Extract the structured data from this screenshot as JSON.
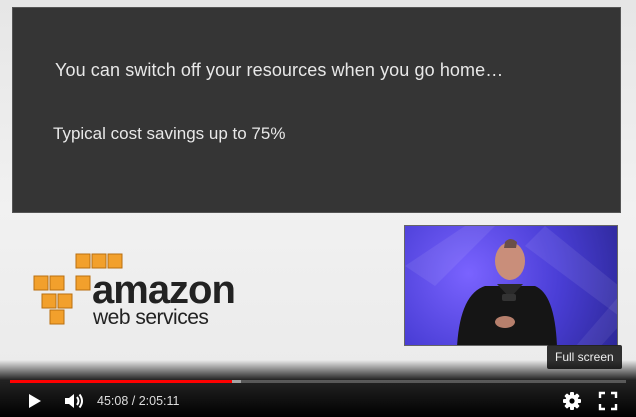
{
  "slide": {
    "line1": "You can switch off your resources when you go home…",
    "line2": "Typical cost savings up to 75%"
  },
  "logo": {
    "word1": "amazon",
    "word2": "web services",
    "cube_color": "#f2a02c"
  },
  "player": {
    "tooltip": "Full screen",
    "current_time": "45:08",
    "separator": " / ",
    "duration": "2:05:11",
    "progress_fraction": 0.3604,
    "buffered_fraction": 0.375,
    "accent_color": "#ff0000",
    "icons": [
      "play-icon",
      "volume-icon",
      "settings-icon",
      "fullscreen-icon"
    ]
  }
}
